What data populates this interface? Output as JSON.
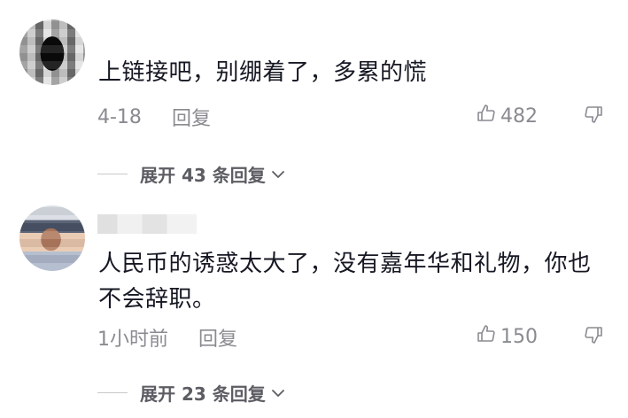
{
  "comments": [
    {
      "text": "上链接吧，别绷着了，多累的慌",
      "date": "4-18",
      "reply_label": "回复",
      "likes": "482",
      "expand_label": "展开 43 条回复",
      "avatar_icon": "blurred-avatar",
      "username_blurred": true
    },
    {
      "text": "人民币的诱惑太大了，没有嘉年华和礼物，你也不会辞职。",
      "date": "1小时前",
      "reply_label": "回复",
      "likes": "150",
      "expand_label": "展开 23 条回复",
      "avatar_icon": "blurred-avatar",
      "username_blurred": true
    }
  ],
  "icons": {
    "like": "thumbs-up-icon",
    "dislike": "thumbs-down-icon",
    "expand": "chevron-down-icon"
  },
  "colors": {
    "text": "#161823",
    "meta": "#8a8b91",
    "expand": "#5c5d63"
  }
}
